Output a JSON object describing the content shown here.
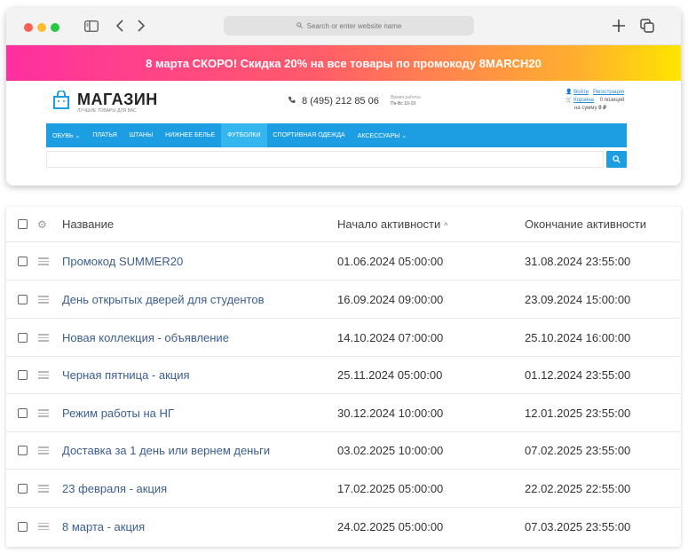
{
  "browser": {
    "url_placeholder": "Search or enter website name",
    "new_tab_icon": "+",
    "tabs_icon": "tabs-icon"
  },
  "promo": {
    "text": "8 марта СКОРО! Скидка 20% на все товары по промокоду 8MARCH20"
  },
  "site": {
    "logo_title": "МАГАЗИН",
    "logo_subtitle": "ЛУЧШИЕ ТОВАРЫ ДЛЯ ВАС",
    "phone": "8 (495) 212 85 06",
    "hours_label": "Время работы:",
    "hours_value": "Пн-Вс 10-19",
    "login": "Войти",
    "register": "Регистрация",
    "cart": "Корзина",
    "cart_count": "0 позиций",
    "cart_sum_label": "на сумму",
    "cart_sum": "0 ₽"
  },
  "nav": {
    "items": [
      {
        "label": "ОБУВЬ ⌄"
      },
      {
        "label": "ПЛАТЬЯ"
      },
      {
        "label": "ШТАНЫ"
      },
      {
        "label": "НИЖНЕЕ БЕЛЬЕ"
      },
      {
        "label": "ФУТБОЛКИ"
      },
      {
        "label": "СПОРТИВНАЯ ОДЕЖДА"
      },
      {
        "label": "АКСЕССУАРЫ ⌄"
      }
    ],
    "active": "ФУТБОЛКИ"
  },
  "table": {
    "headers": {
      "name": "Название",
      "start": "Начало активности",
      "end": "Окончание активности"
    },
    "rows": [
      {
        "name": "Промокод SUMMER20",
        "start": "01.06.2024 05:00:00",
        "end": "31.08.2024 23:55:00"
      },
      {
        "name": "День открытых дверей для студентов",
        "start": "16.09.2024 09:00:00",
        "end": "23.09.2024 15:00:00"
      },
      {
        "name": "Новая коллекция - объявление",
        "start": "14.10.2024 07:00:00",
        "end": "25.10.2024 16:00:00"
      },
      {
        "name": "Черная пятница - акция",
        "start": "25.11.2024 05:00:00",
        "end": "01.12.2024 23:55:00"
      },
      {
        "name": "Режим работы на НГ",
        "start": "30.12.2024 10:00:00",
        "end": "12.01.2025 23:55:00"
      },
      {
        "name": "Доставка за 1 день или вернем деньги",
        "start": "03.02.2025 10:00:00",
        "end": "07.02.2025 23:55:00"
      },
      {
        "name": "23 февраля - акция",
        "start": "17.02.2025 05:00:00",
        "end": "22.02.2025 22:55:00"
      },
      {
        "name": "8 марта - акция",
        "start": "24.02.2025 05:00:00",
        "end": "07.03.2025 23:55:00"
      }
    ]
  },
  "colors": {
    "nav": "#1d9ee3",
    "link": "#3b5e8f",
    "promo_start": "#ff2fa0",
    "promo_end": "#ffe500"
  }
}
